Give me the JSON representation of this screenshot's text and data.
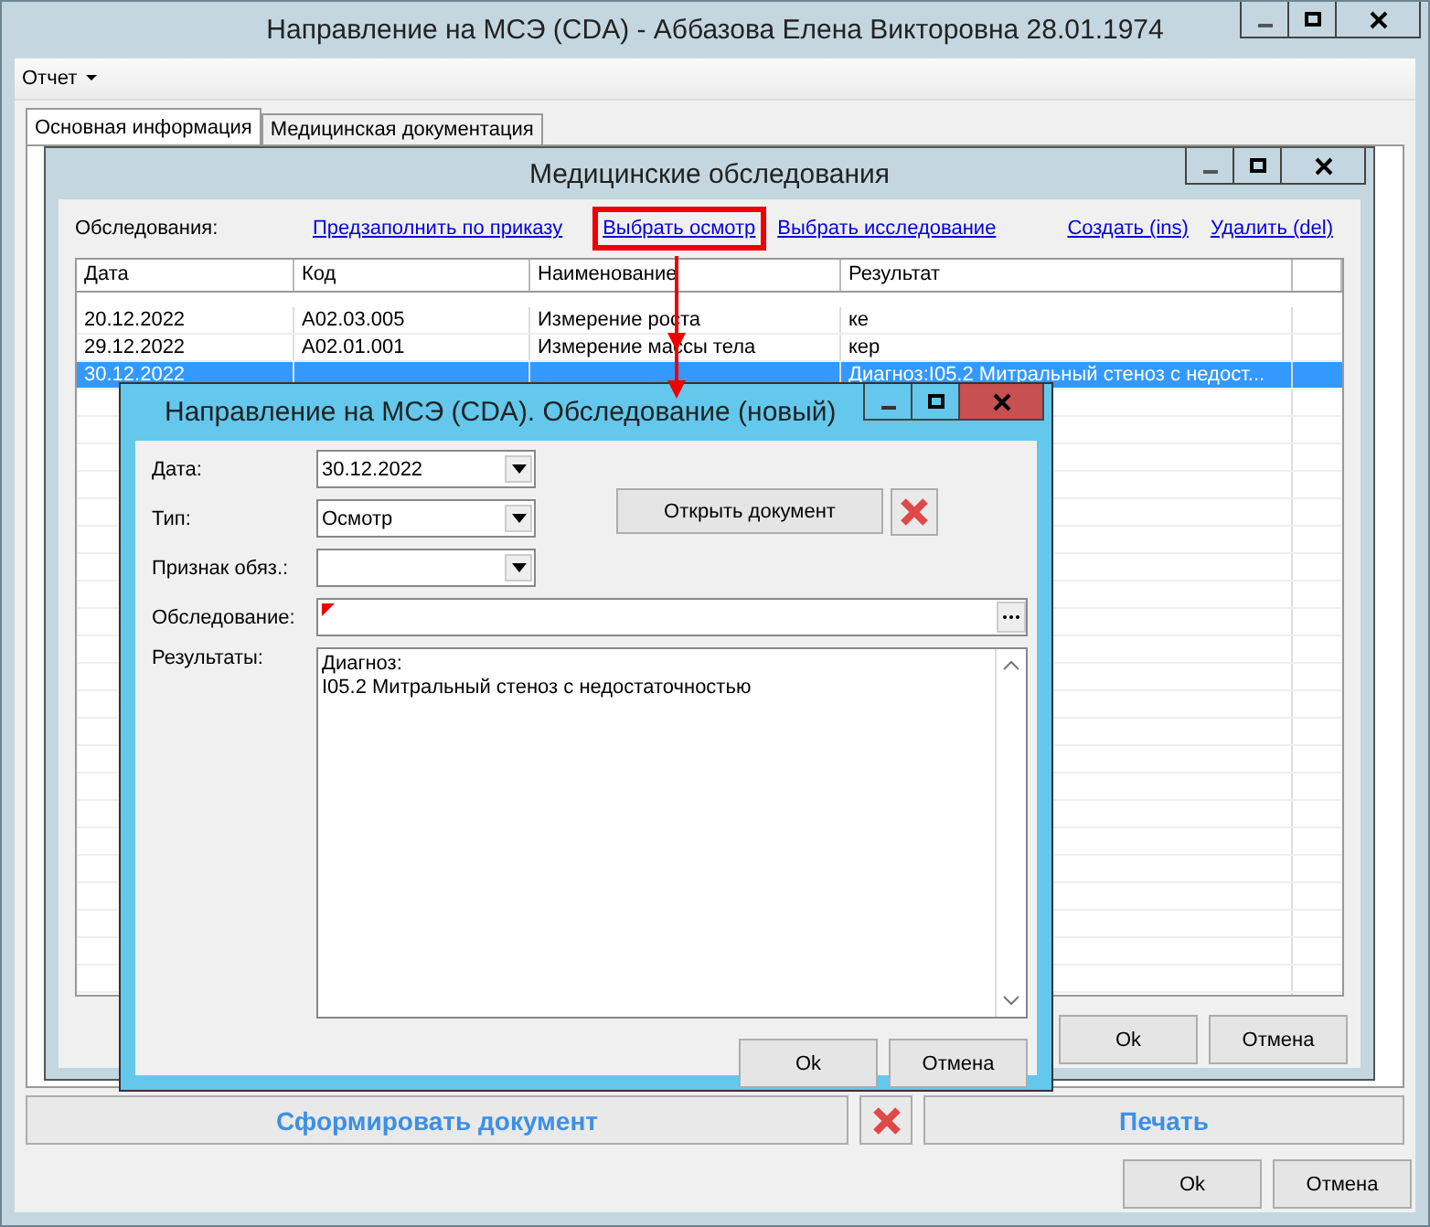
{
  "main_window": {
    "title": "Направление на МСЭ (CDA) - Аббазова Елена Викторовна 28.01.1974",
    "menu": [
      {
        "label": "Отчет"
      }
    ],
    "tabs": [
      {
        "label": "Основная информация",
        "selected": true
      },
      {
        "label": "Медицинская документация",
        "selected": false
      }
    ],
    "generate_button": "Сформировать документ",
    "print_button": "Печать",
    "ok_button": "Ok",
    "cancel_button": "Отмена"
  },
  "exams_window": {
    "title": "Медицинские обследования",
    "label": "Обследования:",
    "links": [
      {
        "label": "Предзаполнить по приказу",
        "highlighted": false
      },
      {
        "label": "Выбрать осмотр",
        "highlighted": true
      },
      {
        "label": "Выбрать исследование",
        "highlighted": false
      },
      {
        "label": "Создать (ins)",
        "highlighted": false
      },
      {
        "label": "Удалить (del)",
        "highlighted": false
      }
    ],
    "columns": [
      "Дата",
      "Код",
      "Наименование",
      "Результат"
    ],
    "rows": [
      {
        "cells": [
          "20.12.2022",
          "A02.03.005",
          "Измерение роста",
          "ке"
        ],
        "selected": false
      },
      {
        "cells": [
          "29.12.2022",
          "A02.01.001",
          "Измерение массы тела",
          "кер"
        ],
        "selected": false
      },
      {
        "cells": [
          "30.12.2022",
          "",
          "",
          "Диагноз:I05.2 Митральный стеноз с недост..."
        ],
        "selected": true
      }
    ],
    "ok_button": "Ok",
    "cancel_button": "Отмена"
  },
  "exam_dialog": {
    "title": "Направление на МСЭ (CDA). Обследование (новый)",
    "fields": [
      {
        "label": "Дата:",
        "value": "30.12.2022"
      },
      {
        "label": "Тип:",
        "value": "Осмотр"
      },
      {
        "label": "Признак обяз.:"
      }
    ],
    "open_button": "Открыть документ",
    "exam_label": "Обследование:",
    "exam_required": true,
    "results_label": "Результаты:",
    "results": [
      "Диагноз:",
      "I05.2 Митральный стеноз с недостаточностью"
    ],
    "ok_button": "Ok",
    "cancel_button": "Отмена"
  }
}
